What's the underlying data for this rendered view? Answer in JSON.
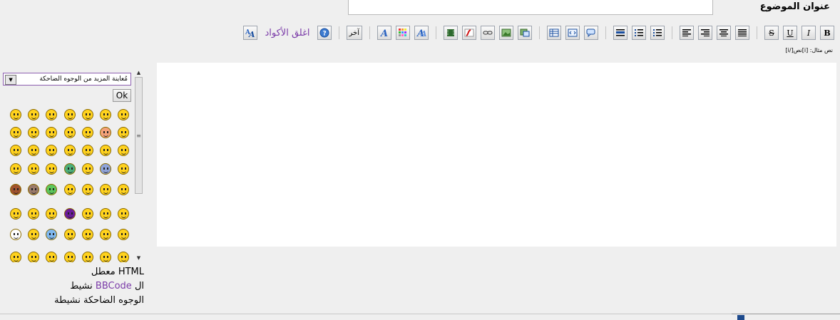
{
  "header": {
    "title_label": "عنوان الموضوع"
  },
  "toolbar": {
    "bold": "B",
    "italic": "I",
    "underline": "U",
    "strike": "S",
    "other_label": "آخر",
    "close_tags_label": "اغلق الأكواد",
    "example_text": "نص مثال: [i]نص[/i]"
  },
  "smilies": {
    "select_label": "مُعاينة المزيد من الوجوه الضاحكة",
    "ok_label": "Ok"
  },
  "status": {
    "html_line": "HTML معطل",
    "bbcode_prefix": "ال",
    "bbcode_word": "BBCode",
    "bbcode_suffix": "نشيط",
    "smilies_line": "الوجوه الضاحكة نشيطة"
  }
}
